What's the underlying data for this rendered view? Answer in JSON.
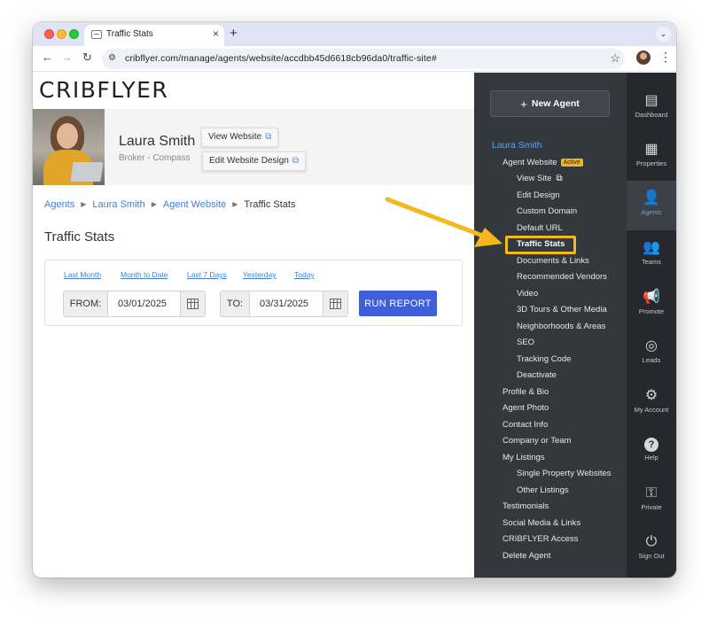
{
  "browser": {
    "tab_title": "Traffic Stats",
    "tab_close": "×",
    "new_tab": "+",
    "tab_menu": "⌄",
    "url": "cribflyer.com/manage/agents/website/accdbb45d6618cb96da0/traffic-site#",
    "nav_back": "←",
    "nav_forward": "→",
    "nav_reload": "↻",
    "star": "☆",
    "menu": "⋮"
  },
  "logo": "CRIBFLYER",
  "agent": {
    "name": "Laura Smith",
    "subtitle": "Broker - Compass",
    "view_website": "View Website",
    "edit_design": "Edit Website Design",
    "ext_glyph": "⧉"
  },
  "breadcrumb": {
    "items": [
      "Agents",
      "Laura Smith",
      "Agent Website"
    ],
    "current": "Traffic Stats",
    "separator": "▶"
  },
  "page_title": "Traffic Stats",
  "report": {
    "quick_links": [
      "Last Month",
      "Month to Date",
      "Last 7 Days",
      "Yesterday",
      "Today"
    ],
    "from_label": "FROM:",
    "from_value": "03/01/2025",
    "to_label": "TO:",
    "to_value": "03/31/2025",
    "run_label": "RUN REPORT"
  },
  "sidenav": {
    "new_agent": "New Agent",
    "plus": "+",
    "agent_name": "Laura Smith",
    "agent_website": "Agent Website",
    "active_badge": "Active",
    "website_items": [
      "View Site",
      "Edit Design",
      "Custom Domain",
      "Default URL",
      "Traffic Stats",
      "Documents & Links",
      "Recommended Vendors",
      "Video",
      "3D Tours & Other Media",
      "Neighborhoods & Areas",
      "SEO",
      "Tracking Code",
      "Deactivate"
    ],
    "current_item": "Traffic Stats",
    "section_items": [
      "Profile & Bio",
      "Agent Photo",
      "Contact Info",
      "Company or Team",
      "My Listings"
    ],
    "listing_items": [
      "Single Property Websites",
      "Other Listings"
    ],
    "bottom_items": [
      "Testimonials",
      "Social Media & Links",
      "CRIBFLYER Access",
      "Delete Agent"
    ]
  },
  "rail": [
    {
      "label": "Dashboard",
      "icon": "dashboard-icon",
      "glyph": "▤"
    },
    {
      "label": "Properties",
      "icon": "properties-icon",
      "glyph": "▦"
    },
    {
      "label": "Agents",
      "icon": "agents-icon",
      "glyph": "👤"
    },
    {
      "label": "Teams",
      "icon": "teams-icon",
      "glyph": "👥"
    },
    {
      "label": "Promote",
      "icon": "megaphone-icon",
      "glyph": "📢"
    },
    {
      "label": "Leads",
      "icon": "target-icon",
      "glyph": "◎"
    },
    {
      "label": "My Account",
      "icon": "gear-icon",
      "glyph": "⚙"
    },
    {
      "label": "Help",
      "icon": "help-icon",
      "glyph": "?"
    },
    {
      "label": "Private",
      "icon": "key-icon",
      "glyph": "⚿"
    },
    {
      "label": "Sign Out",
      "icon": "power-icon",
      "glyph": "⏻"
    }
  ],
  "active_rail": "Agents",
  "colors": {
    "accent": "#3f7fd8",
    "highlight": "#f3b81c",
    "run_button": "#3f5ed9",
    "sidebar": "#33373e"
  }
}
